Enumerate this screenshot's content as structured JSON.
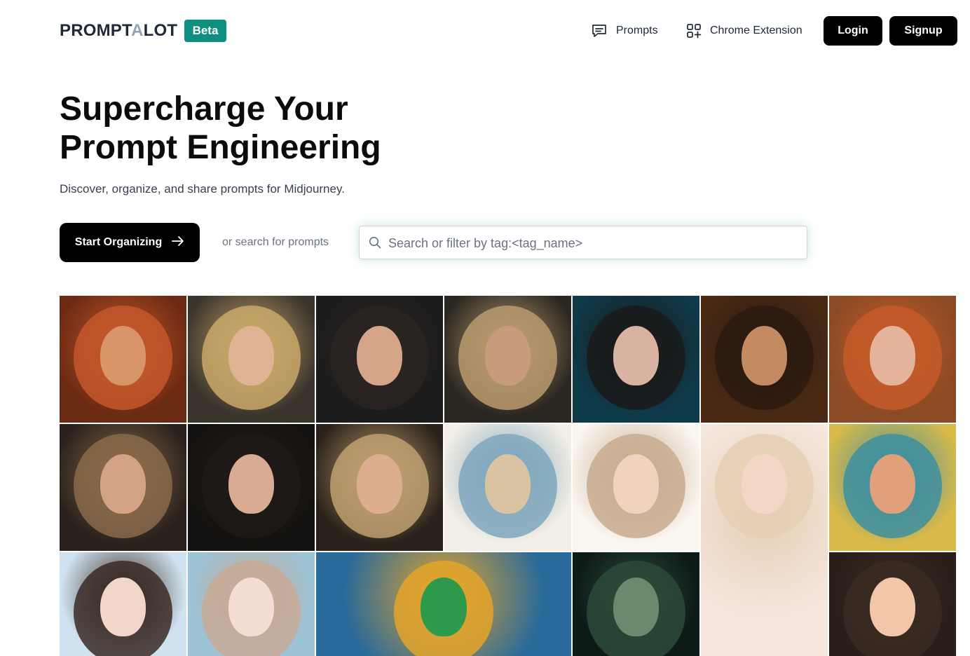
{
  "brand": {
    "logo_part1": "PROMPT",
    "logo_part2": "A",
    "logo_part3": "LOT",
    "badge": "Beta",
    "badge_color": "#0f8f7f"
  },
  "nav": {
    "prompts_label": "Prompts",
    "prompts_icon": "chat-bubble-icon",
    "extension_label": "Chrome Extension",
    "extension_icon": "apps-add-icon",
    "login_label": "Login",
    "signup_label": "Signup"
  },
  "hero": {
    "title_line1": "Supercharge Your",
    "title_line2": "Prompt Engineering",
    "subtitle": "Discover, organize, and share prompts for Midjourney.",
    "cta_label": "Start Organizing",
    "cta_icon": "arrow-right-icon",
    "or_text": "or search for prompts"
  },
  "search": {
    "placeholder": "Search or filter by tag:<tag_name>",
    "value": "",
    "icon": "search-icon"
  },
  "gallery": {
    "tiles": [
      {
        "name": "redhead-freckles-glasses-portrait",
        "bg": "#6b2a12",
        "accent": "#c4572a",
        "skin": "#d9956a"
      },
      {
        "name": "curly-blonde-red-lips-portrait",
        "bg": "#3a342c",
        "accent": "#c9a86a",
        "skin": "#e0b394"
      },
      {
        "name": "dark-hair-smiling-woman-portrait",
        "bg": "#1c1c1c",
        "accent": "#2a2422",
        "skin": "#d6a488"
      },
      {
        "name": "wavy-blonde-moody-portrait",
        "bg": "#2a2620",
        "accent": "#b99a6e",
        "skin": "#c79b7c"
      },
      {
        "name": "blue-eyes-red-coat-portrait",
        "bg": "#0f3a4a",
        "accent": "#1a1a1a",
        "skin": "#d9b2a2"
      },
      {
        "name": "woman-with-glasses-smiling-portrait",
        "bg": "#4a2a14",
        "accent": "#2b1a10",
        "skin": "#c48a62"
      },
      {
        "name": "curly-redhead-glasses-portrait",
        "bg": "#8a4a24",
        "accent": "#c65a2a",
        "skin": "#e4b49a"
      },
      {
        "name": "curly-brunette-portrait",
        "bg": "#2a211c",
        "accent": "#8a6a4a",
        "skin": "#d4a386"
      },
      {
        "name": "long-dark-hair-portrait",
        "bg": "#141210",
        "accent": "#1e1a16",
        "skin": "#d8ab92"
      },
      {
        "name": "blonde-blazer-portrait",
        "bg": "#2a221a",
        "accent": "#c0a070",
        "skin": "#dcae8e"
      },
      {
        "name": "watercolor-beach-couple",
        "bg": "#f4efe6",
        "accent": "#7fa7bd",
        "skin": "#d9c3a0"
      },
      {
        "name": "watercolor-girls-gift",
        "bg": "#faf6f0",
        "accent": "#c8ab8e",
        "skin": "#f0d2bd"
      },
      {
        "name": "anime-blonde-red-dress",
        "bg": "#f6e7df",
        "accent": "#e5cfb4",
        "skin": "#f4d6c6"
      },
      {
        "name": "comic-tennis-player",
        "bg": "#d8b94a",
        "accent": "#3e8fa0",
        "skin": "#e0a07a"
      },
      {
        "name": "anime-girl-red-shirt",
        "bg": "#cfe2ef",
        "accent": "#3a2a24",
        "skin": "#f2d6c8"
      },
      {
        "name": "anime-girl-beach-braids",
        "bg": "#9cc3d6",
        "accent": "#c8aa96",
        "skin": "#f3dcd2"
      },
      {
        "name": "dot-art-frog-hat",
        "bg": "#2a6a9a",
        "accent": "#e3a42c",
        "skin": "#2c9a4a"
      },
      {
        "name": "dark-forest-leaves",
        "bg": "#0d1a18",
        "accent": "#2a4a3a",
        "skin": "#6a8a70"
      },
      {
        "name": "cartoon-girl-flower-hair",
        "bg": "#2a1e1a",
        "accent": "#3a2a22",
        "skin": "#f2c6a8"
      }
    ]
  }
}
